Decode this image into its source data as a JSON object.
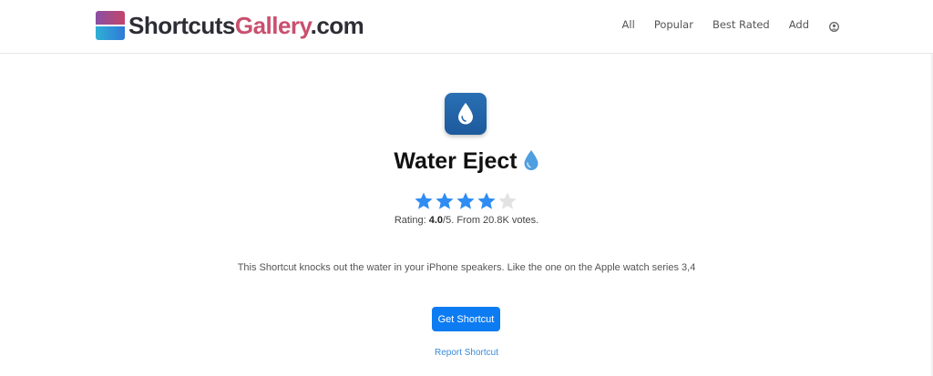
{
  "logo": {
    "part1": "Shortcuts",
    "part2": "Gallery",
    "part3": ".com"
  },
  "nav": {
    "all": "All",
    "popular": "Popular",
    "best_rated": "Best Rated",
    "add": "Add",
    "account_icon": "user-circle-icon"
  },
  "shortcut": {
    "title": "Water Eject",
    "icon": "water-drop-icon",
    "icon_color": "#1f63a8",
    "rating": {
      "prefix": "Rating: ",
      "value": "4.0",
      "suffix": "/5. From 20.8K votes.",
      "stars_filled": 4,
      "stars_total": 5,
      "star_color": "#2f8cf2",
      "star_empty_color": "#e2e2e2"
    },
    "description": "This Shortcut knocks out the water in your iPhone speakers. Like the one on the Apple watch series 3,4",
    "get_button": "Get Shortcut",
    "report_link": "Report Shortcut"
  },
  "colors": {
    "accent": "#0d7cf2",
    "link": "#3a8bd6"
  }
}
